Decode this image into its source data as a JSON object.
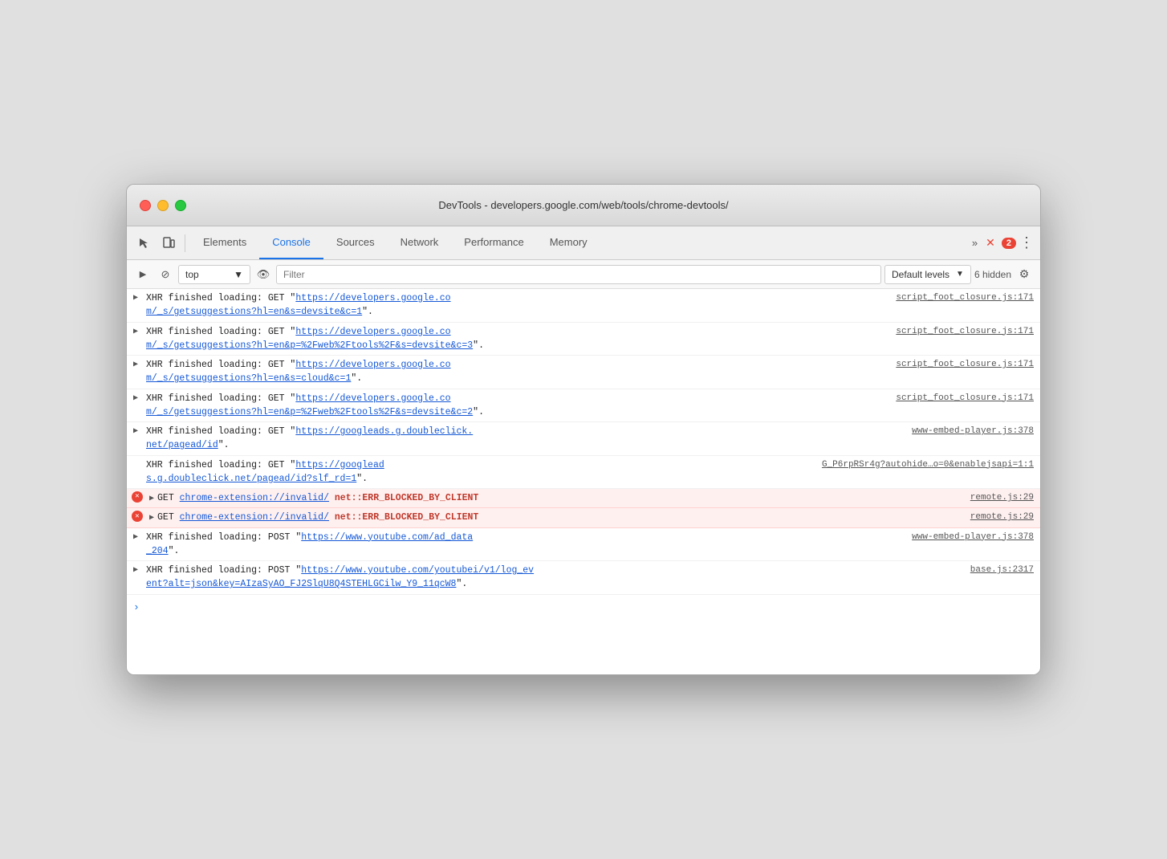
{
  "window": {
    "title": "DevTools - developers.google.com/web/tools/chrome-devtools/"
  },
  "toolbar": {
    "tabs": [
      {
        "id": "elements",
        "label": "Elements",
        "active": false
      },
      {
        "id": "console",
        "label": "Console",
        "active": true
      },
      {
        "id": "sources",
        "label": "Sources",
        "active": false
      },
      {
        "id": "network",
        "label": "Network",
        "active": false
      },
      {
        "id": "performance",
        "label": "Performance",
        "active": false
      },
      {
        "id": "memory",
        "label": "Memory",
        "active": false
      }
    ],
    "more_label": "»",
    "error_count": "2",
    "menu_icon": "⋮"
  },
  "console_toolbar": {
    "run_label": "▶",
    "block_label": "⊘",
    "context": "top",
    "context_arrow": "▼",
    "eye_icon": "👁",
    "filter_placeholder": "Filter",
    "levels_label": "Default levels",
    "levels_arrow": "▼",
    "hidden_count": "6 hidden",
    "settings_icon": "⚙"
  },
  "log_entries": [
    {
      "id": 1,
      "type": "xhr",
      "arrow": "▶",
      "text": "XHR finished loading: GET \"https://developers.google.co",
      "text2": "m/_s/getsuggestions?hl=en&s=devsite&c=1\".",
      "source": "script_foot_closure.js:171",
      "has_link": true,
      "is_error": false
    },
    {
      "id": 2,
      "type": "xhr",
      "arrow": "▶",
      "text": "XHR finished loading: GET \"https://developers.google.co",
      "text2": "m/_s/getsuggestions?hl=en&p=%2Fweb%2Ftools%2F&s=devsite&c=3\".",
      "source": "script_foot_closure.js:171",
      "has_link": true,
      "is_error": false
    },
    {
      "id": 3,
      "type": "xhr",
      "arrow": "▶",
      "text": "XHR finished loading: GET \"https://developers.google.co",
      "text2": "m/_s/getsuggestions?hl=en&s=cloud&c=1\".",
      "source": "script_foot_closure.js:171",
      "has_link": true,
      "is_error": false
    },
    {
      "id": 4,
      "type": "xhr",
      "arrow": "▶",
      "text": "XHR finished loading: GET \"https://developers.google.co",
      "text2": "m/_s/getsuggestions?hl=en&p=%2Fweb%2Ftools%2F&s=devsite&c=2\".",
      "source": "script_foot_closure.js:171",
      "has_link": true,
      "is_error": false
    },
    {
      "id": 5,
      "type": "xhr",
      "arrow": "▶",
      "text": "XHR finished loading: GET \"https://googleads.g.doubleclick.",
      "text2": "net/pagead/id\".",
      "source": "www-embed-player.js:378",
      "has_link": true,
      "is_error": false
    },
    {
      "id": 6,
      "type": "xhr",
      "arrow": null,
      "text": "XHR finished loading: GET \"https://googlead",
      "text2": "s.g.doubleclick.net/pagead/id?slf_rd=1\".",
      "source": "G_P6rpRSr4g?autohide…o=0&enablejsapi=1:1",
      "has_link": true,
      "is_error": false
    },
    {
      "id": 7,
      "type": "get_error",
      "arrow": "▶",
      "text_before": "GET ",
      "url": "chrome-extension://invalid/",
      "error_text": " net::ERR_BLOCKED_BY_CLIENT",
      "source": "remote.js:29",
      "has_link": true,
      "is_error": true
    },
    {
      "id": 8,
      "type": "get_error",
      "arrow": "▶",
      "text_before": "GET ",
      "url": "chrome-extension://invalid/",
      "error_text": " net::ERR_BLOCKED_BY_CLIENT",
      "source": "remote.js:29",
      "has_link": true,
      "is_error": true
    },
    {
      "id": 9,
      "type": "xhr",
      "arrow": "▶",
      "text": "XHR finished loading: POST \"https://www.youtube.com/ad_data",
      "text2": "_204\".",
      "source": "www-embed-player.js:378",
      "has_link": true,
      "is_error": false
    },
    {
      "id": 10,
      "type": "xhr",
      "arrow": "▶",
      "text": "XHR finished loading: POST \"https://www.youtube.com/youtubei/v1/log_ev",
      "text2": "ent?alt=json&key=AIzaSyAO_FJ2SlqU8Q4STEHLGCilw_Y9_11qcW8\".",
      "source": "base.js:2317",
      "has_link": true,
      "is_error": false
    }
  ]
}
